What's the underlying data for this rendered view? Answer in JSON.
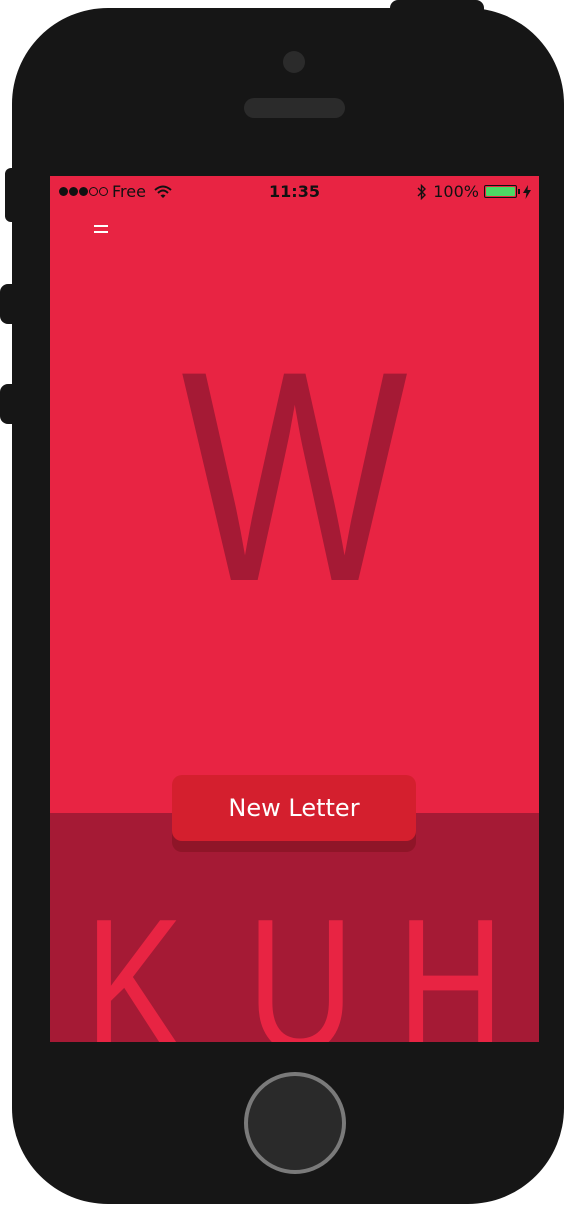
{
  "status_bar": {
    "carrier": "Free",
    "signal_bars": 3,
    "signal_max": 5,
    "time": "11:35",
    "battery": "100%",
    "battery_level": 1.0
  },
  "main": {
    "current_letter": "W"
  },
  "actions": {
    "new_letter_label": "New Letter"
  },
  "choices": [
    "K",
    "U",
    "H"
  ],
  "colors": {
    "background": "#e82443",
    "dark_accent": "#a51a35",
    "button": "#d41f2e",
    "battery": "#4cd964"
  },
  "icons": {
    "menu": "hamburger-menu-icon",
    "wifi": "wifi-icon",
    "bluetooth": "bluetooth-icon",
    "battery": "battery-icon",
    "charging": "charging-bolt-icon"
  }
}
